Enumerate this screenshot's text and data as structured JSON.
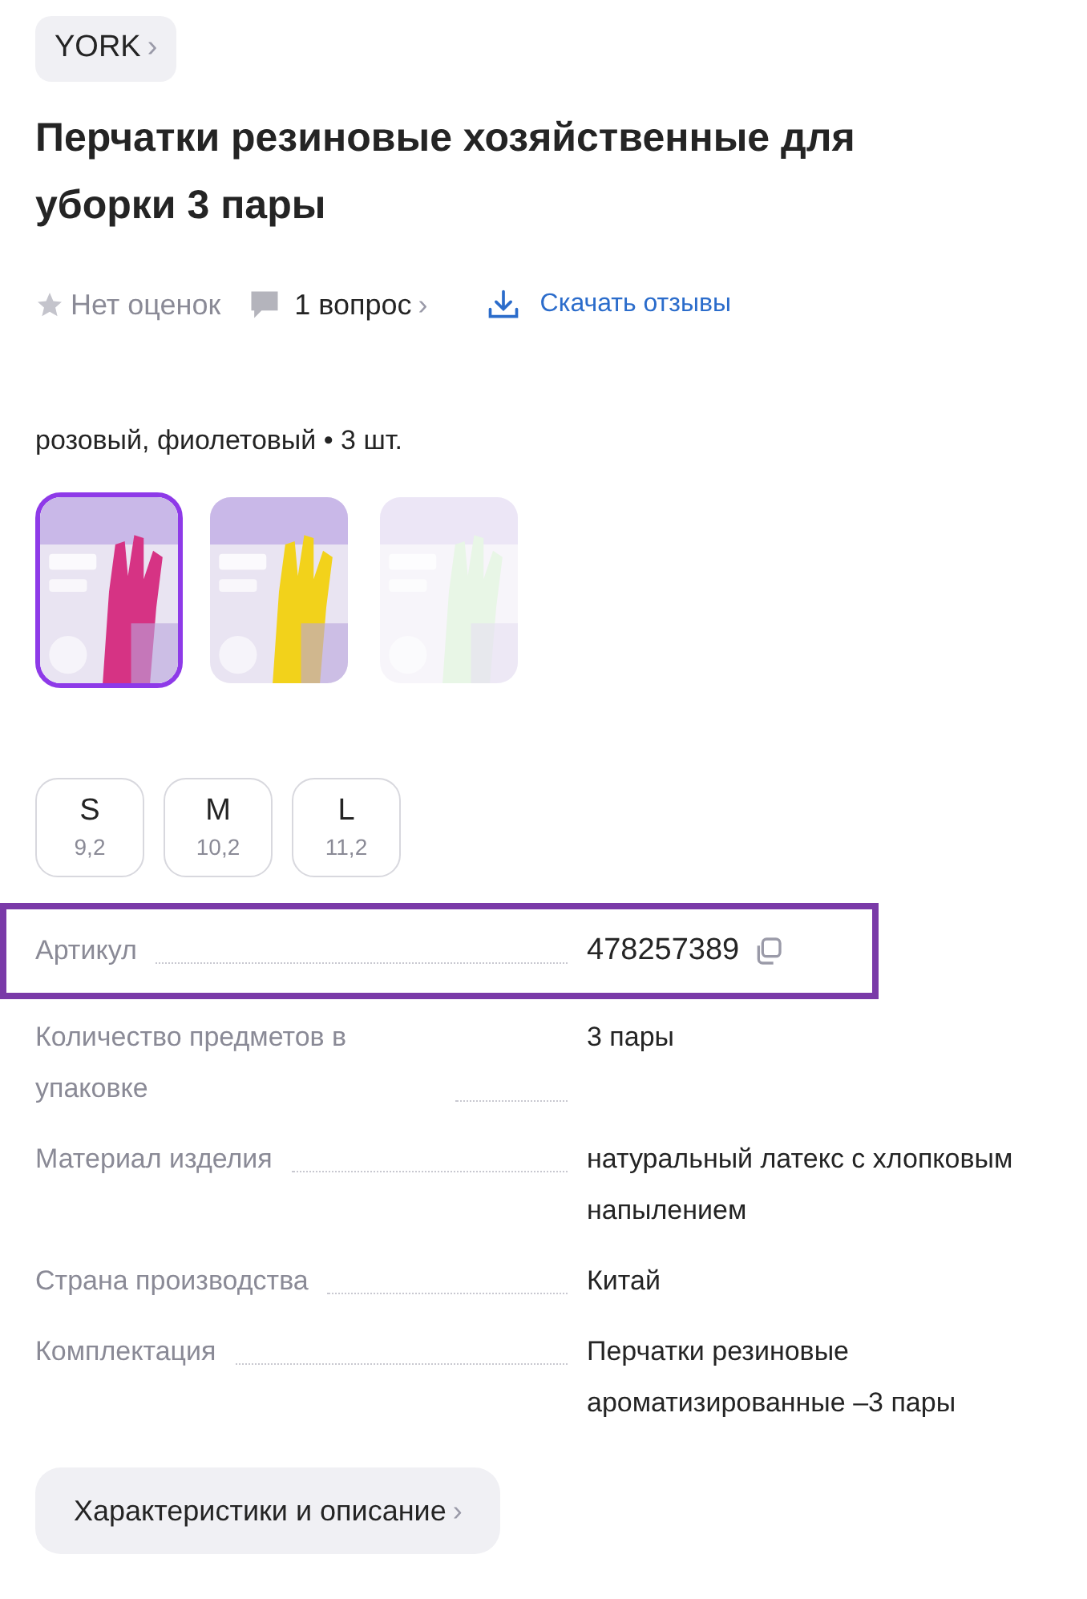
{
  "brand": {
    "label": "YORK",
    "chevron": "›"
  },
  "title": "Перчатки резиновые хозяйственные для уборки 3 пары",
  "meta": {
    "rating": "Нет оценок",
    "questions": "1 вопрос",
    "questions_chevron": "›",
    "download": "Скачать отзывы"
  },
  "variant_caption": "розовый, фиолетовый • 3 шт.",
  "variants": [
    {
      "selected": true,
      "available": true
    },
    {
      "selected": false,
      "available": true
    },
    {
      "selected": false,
      "available": false
    }
  ],
  "sizes": [
    {
      "label": "S",
      "measure": "9,2"
    },
    {
      "label": "M",
      "measure": "10,2"
    },
    {
      "label": "L",
      "measure": "11,2"
    }
  ],
  "specs": [
    {
      "label": "Артикул",
      "value": "478257389",
      "highlighted": true,
      "copyable": true
    },
    {
      "label": "Количество предметов в упаковке",
      "value": "3 пары",
      "highlighted": false,
      "copyable": false
    },
    {
      "label": "Материал изделия",
      "value": "натуральный латекс с хлопковым напылением",
      "highlighted": false,
      "copyable": false
    },
    {
      "label": "Страна производства",
      "value": "Китай",
      "highlighted": false,
      "copyable": false
    },
    {
      "label": "Комплектация",
      "value": "Перчатки резиновые ароматизированные –3 пары",
      "highlighted": false,
      "copyable": false
    }
  ],
  "details_button": {
    "label": "Характеристики и описание",
    "chevron": "›"
  }
}
